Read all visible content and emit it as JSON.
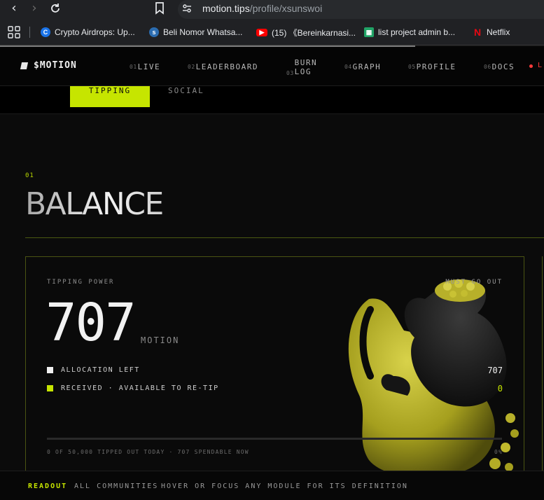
{
  "browser": {
    "url_host": "motion.tips",
    "url_path": "/profile/xsunswoi",
    "bookmarks": [
      {
        "label": "Crypto Airdrops: Up...",
        "icon": "coin-favicon-icon",
        "color": "#1a73e8"
      },
      {
        "label": "Beli Nomor Whatsa...",
        "icon": "water-drop-favicon-icon",
        "color": "#4fa3ff"
      },
      {
        "label": "(15) 《Bereinkarnasi...",
        "icon": "youtube-favicon-icon",
        "color": "#ff0000"
      },
      {
        "label": "list project admin b...",
        "icon": "sheet-favicon-icon",
        "color": "#21a366"
      },
      {
        "label": "Netflix",
        "icon": "netflix-favicon-icon",
        "color": "#e50914"
      }
    ]
  },
  "site": {
    "logo": "$MOTION",
    "nav": [
      {
        "num": "01",
        "label": "LIVE"
      },
      {
        "num": "02",
        "label": "LEADERBOARD"
      },
      {
        "num": "03",
        "label_lines": [
          "BURN",
          "LOG"
        ]
      },
      {
        "num": "04",
        "label": "GRAPH"
      },
      {
        "num": "05",
        "label": "PROFILE"
      },
      {
        "num": "06",
        "label": "DOCS"
      }
    ],
    "live_partial": "L",
    "accent": "#c6e500"
  },
  "tabs": {
    "active": "TIPPING",
    "other": "SOCIAL"
  },
  "section": {
    "number": "01",
    "title": "BALANCE"
  },
  "card": {
    "label": "TIPPING POWER",
    "corner_label": "MUST GO OUT",
    "value": "707",
    "unit": "MOTION",
    "legend": [
      {
        "label": "ALLOCATION LEFT",
        "value": "707",
        "color": "#f0f0f0"
      },
      {
        "label": "RECEIVED · AVAILABLE TO RE-TIP",
        "value": "0",
        "color": "#c6e500"
      }
    ],
    "progress_fraction": 0,
    "footer_left": "0 OF 50,000 TIPPED OUT TODAY · 707 SPENDABLE NOW",
    "footer_right": "0%"
  },
  "readout": {
    "label": "READOUT",
    "scope": "ALL COMMUNITIES",
    "hint": "HOVER OR FOCUS ANY MODULE FOR ITS DEFINITION"
  }
}
